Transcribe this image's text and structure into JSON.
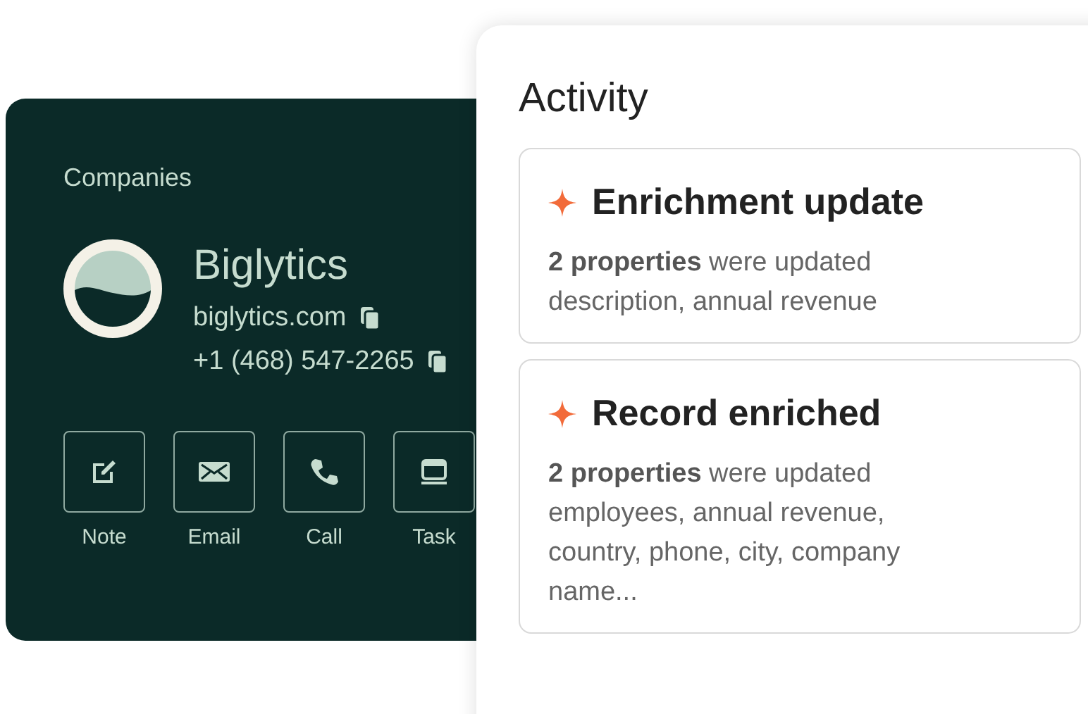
{
  "company_card": {
    "heading": "Companies",
    "name": "Biglytics",
    "website": "biglytics.com",
    "phone": "+1 (468) 547-2265",
    "actions": [
      {
        "kind": "note",
        "label": "Note"
      },
      {
        "kind": "email",
        "label": "Email"
      },
      {
        "kind": "call",
        "label": "Call"
      },
      {
        "kind": "task",
        "label": "Task"
      }
    ]
  },
  "activity": {
    "title": "Activity",
    "items": [
      {
        "title": "Enrichment update",
        "summary": "**2 properties** were updated",
        "details": "description, annual revenue"
      },
      {
        "title": "Record enriched",
        "summary": "**2 properties** were updated",
        "details": "employees, annual revenue, country, phone, city, company name..."
      }
    ]
  }
}
